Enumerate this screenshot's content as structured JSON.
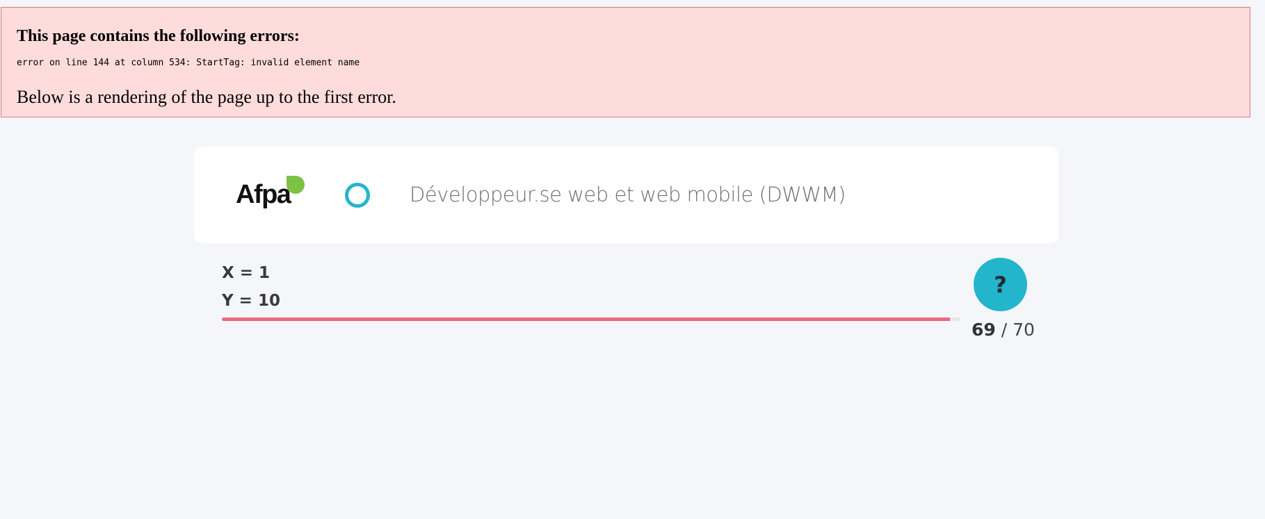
{
  "error": {
    "title": "This page contains the following errors:",
    "detail": "error on line 144 at column 534: StartTag: invalid element name",
    "below": "Below is a rendering of the page up to the first error."
  },
  "header": {
    "logo_text": "Afpa",
    "course_title": "Développeur.se web et web mobile (DWWM)",
    "status_icon": "ring-icon",
    "accent_color": "#23b5cc",
    "logo_leaf_color": "#7cc246"
  },
  "question": {
    "lines": [
      "X = 1",
      "Y = 10"
    ],
    "help_label": "?",
    "help_icon": "question-icon"
  },
  "progress": {
    "current": "69",
    "separator": " / ",
    "total": "70",
    "fraction": 0.9857,
    "bar_color": "#e8697d"
  }
}
